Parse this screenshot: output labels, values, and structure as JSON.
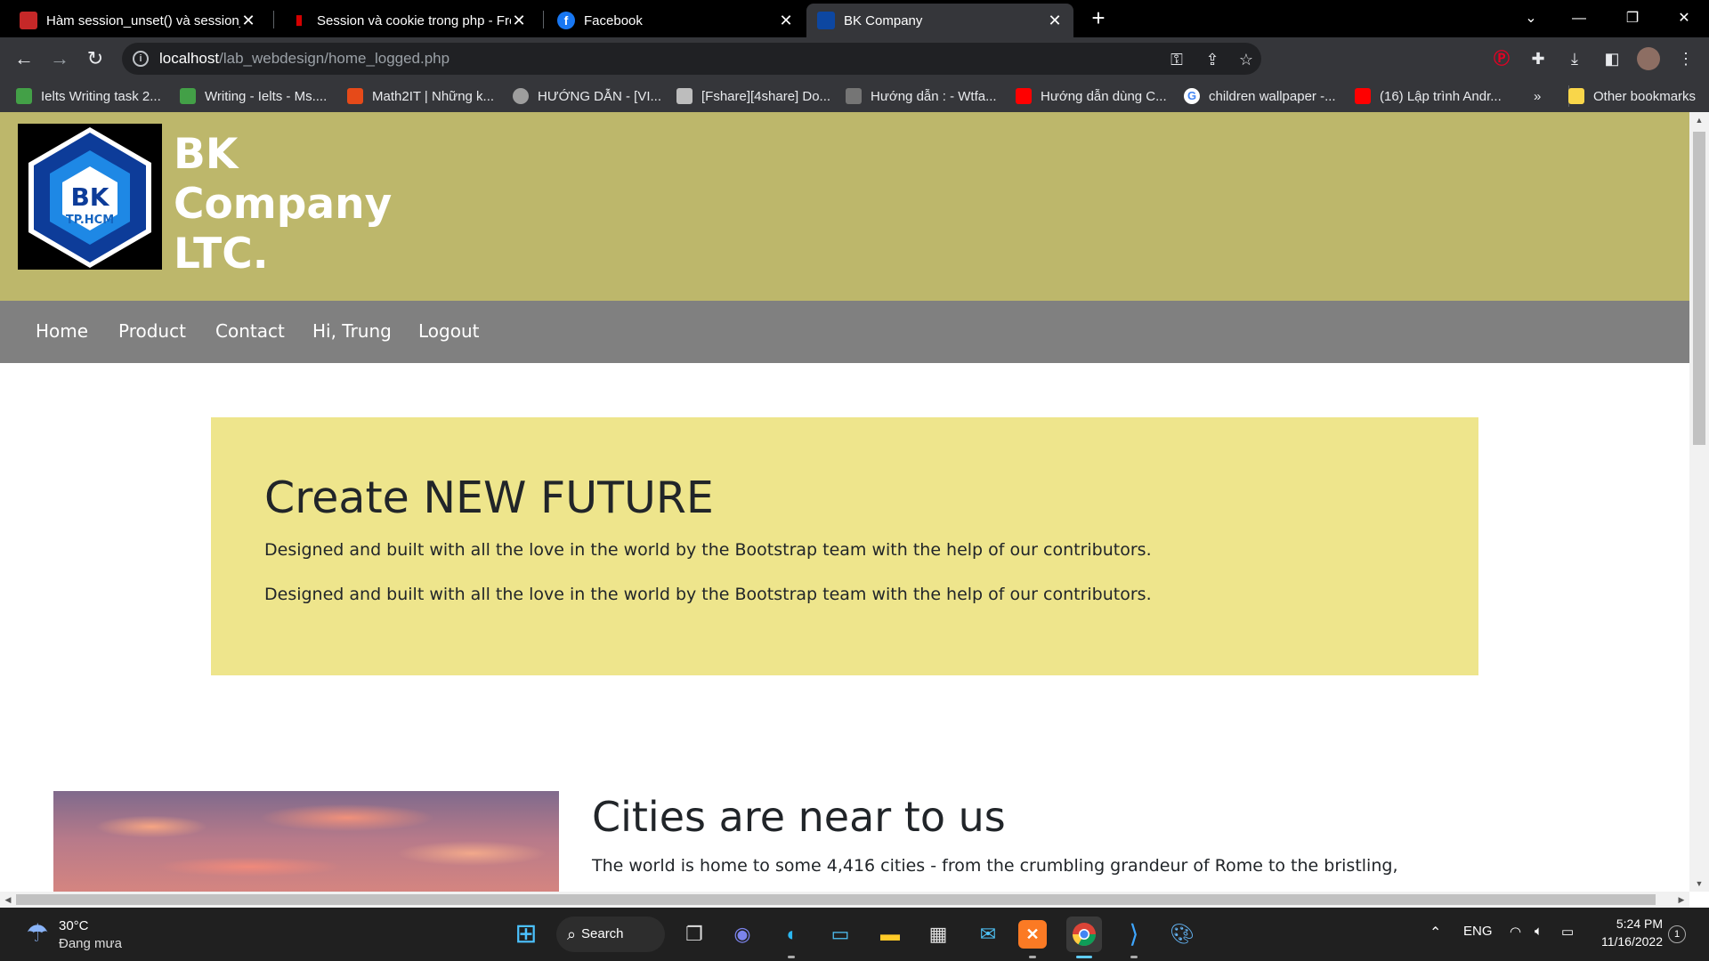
{
  "browser": {
    "tabs": [
      {
        "title": "Hàm session_unset() và session_d",
        "favicon_color": "#c62828",
        "active": false
      },
      {
        "title": "Session và cookie trong php - Fre",
        "favicon_color": "#d50000",
        "active": false
      },
      {
        "title": "Facebook",
        "favicon_color": "#1877f2",
        "active": false
      },
      {
        "title": "BK Company",
        "favicon_color": "#0d47a1",
        "active": true
      }
    ],
    "url_host": "localhost",
    "url_path": "/lab_webdesign/home_logged.php",
    "bookmarks": [
      {
        "label": "Ielts Writing task 2...",
        "color": "#43a047"
      },
      {
        "label": "Writing - Ielts - Ms....",
        "color": "#43a047"
      },
      {
        "label": "Math2IT | Những k...",
        "color": "#e64a19"
      },
      {
        "label": "HƯỚNG DẪN - [VI...",
        "color": "#9e9e9e"
      },
      {
        "label": "[Fshare][4share] Do...",
        "color": "#bdbdbd"
      },
      {
        "label": "Hướng dẫn : - Wtfa...",
        "color": "#757575"
      },
      {
        "label": "Hướng dẫn dùng C...",
        "color": "#ff0000"
      },
      {
        "label": "children wallpaper -...",
        "color": "#4285f4"
      },
      {
        "label": "(16) Lập trình Andr...",
        "color": "#ff0000"
      }
    ],
    "bookmarks_overflow": "»",
    "other_bookmarks": "Other bookmarks"
  },
  "site": {
    "brand_lines": [
      "BK",
      "Company",
      "LTC."
    ],
    "logo": {
      "line1": "BK",
      "line2": "TP.HCM"
    },
    "nav": [
      "Home",
      "Product",
      "Contact",
      "Hi, Trung",
      "Logout"
    ],
    "colors": {
      "header": "#bdb76b",
      "nav": "#808080",
      "jumbotron": "#eee58c"
    }
  },
  "jumbotron": {
    "title": "Create NEW FUTURE",
    "paragraphs": [
      "Designed and built with all the love in the world by the Bootstrap team with the help of our contributors.",
      "Designed and built with all the love in the world by the Bootstrap team with the help of our contributors."
    ]
  },
  "cities": {
    "title": "Cities are near to us",
    "text": "The world is home to some 4,416 cities - from the crumbling grandeur of Rome to the bristling,"
  },
  "taskbar": {
    "weather_temp": "30°C",
    "weather_desc": "Đang mưa",
    "search_label": "Search",
    "language": "ENG",
    "time": "5:24 PM",
    "date": "11/16/2022",
    "notifications": "1"
  }
}
